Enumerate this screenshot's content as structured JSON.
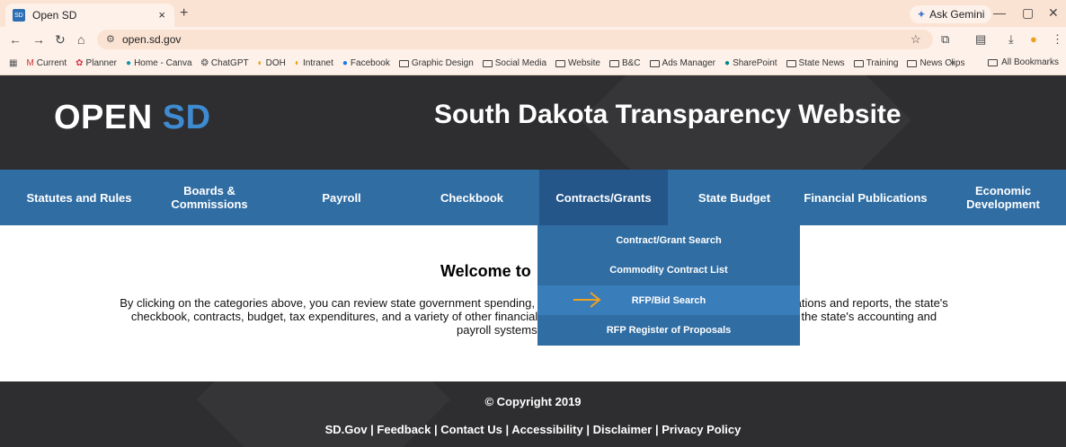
{
  "browser": {
    "tab_title": "Open SD",
    "tab_favicon": "SD",
    "tab_close": "×",
    "new_tab": "+",
    "gemini_label": "Ask Gemini",
    "url": "open.sd.gov",
    "bookmarks": [
      "Current",
      "Planner",
      "Home - Canva",
      "ChatGPT",
      "DOH",
      "Intranet",
      "Facebook",
      "Graphic Design",
      "Social Media",
      "Website",
      "B&C",
      "Ads Manager",
      "SharePoint",
      "State News",
      "Training",
      "News Clips"
    ],
    "more_bookmarks": "»",
    "all_bookmarks": "All Bookmarks"
  },
  "header": {
    "logo_open": "OPEN",
    "logo_sd": "SD",
    "title": "South Dakota Transparency Website"
  },
  "nav": {
    "items": [
      "Statutes and Rules",
      "Boards & Commissions",
      "Payroll",
      "Checkbook",
      "Contracts/Grants",
      "State Budget",
      "Financial Publications",
      "Economic Development"
    ]
  },
  "dropdown": {
    "items": [
      "Contract/Grant Search",
      "Commodity Contract List",
      "RFP/Bid Search",
      "RFP Register of Proposals"
    ]
  },
  "main": {
    "welcome": "Welcome to",
    "intro_line1": "By clicking on the categories above, you can review state government spending, s                                                                      ublications and reports, the state's",
    "intro_line2": "checkbook, contracts, budget, tax expenditures, and a variety of other financial in                                                                 ectly to the state's accounting and",
    "intro_line3": "payroll systems, so the data p"
  },
  "footer": {
    "copyright": "© Copyright 2019",
    "links": "SD.Gov | Feedback | Contact Us | Accessibility | Disclaimer | Privacy Policy"
  },
  "colors": {
    "header_bg": "#2e2e30",
    "nav_bg": "#2f6da3",
    "accent_sd": "#3f8bd2",
    "arrow": "#f0a020"
  }
}
